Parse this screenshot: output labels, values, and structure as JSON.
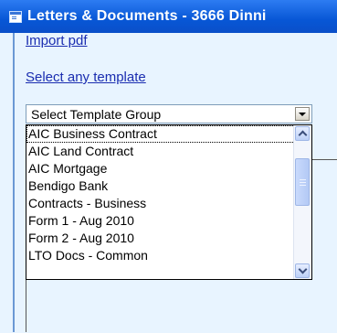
{
  "window": {
    "title": "Letters & Documents - 3666 Dinni",
    "icon": "window-app-icon"
  },
  "links": {
    "import_pdf": "Import pdf",
    "select_template": "Select any template"
  },
  "template_select": {
    "value": "Select Template Group",
    "options": [
      "AIC Business Contract",
      "AIC Land Contract",
      "AIC Mortgage",
      "Bendigo Bank",
      "Contracts - Business",
      "Form 1 - Aug 2010",
      "Form 2 - Aug 2010",
      "LTO Docs - Common"
    ]
  },
  "colors": {
    "titlebar": "#0a57d6",
    "background": "#e8f4ff",
    "link": "#1a2db0"
  }
}
